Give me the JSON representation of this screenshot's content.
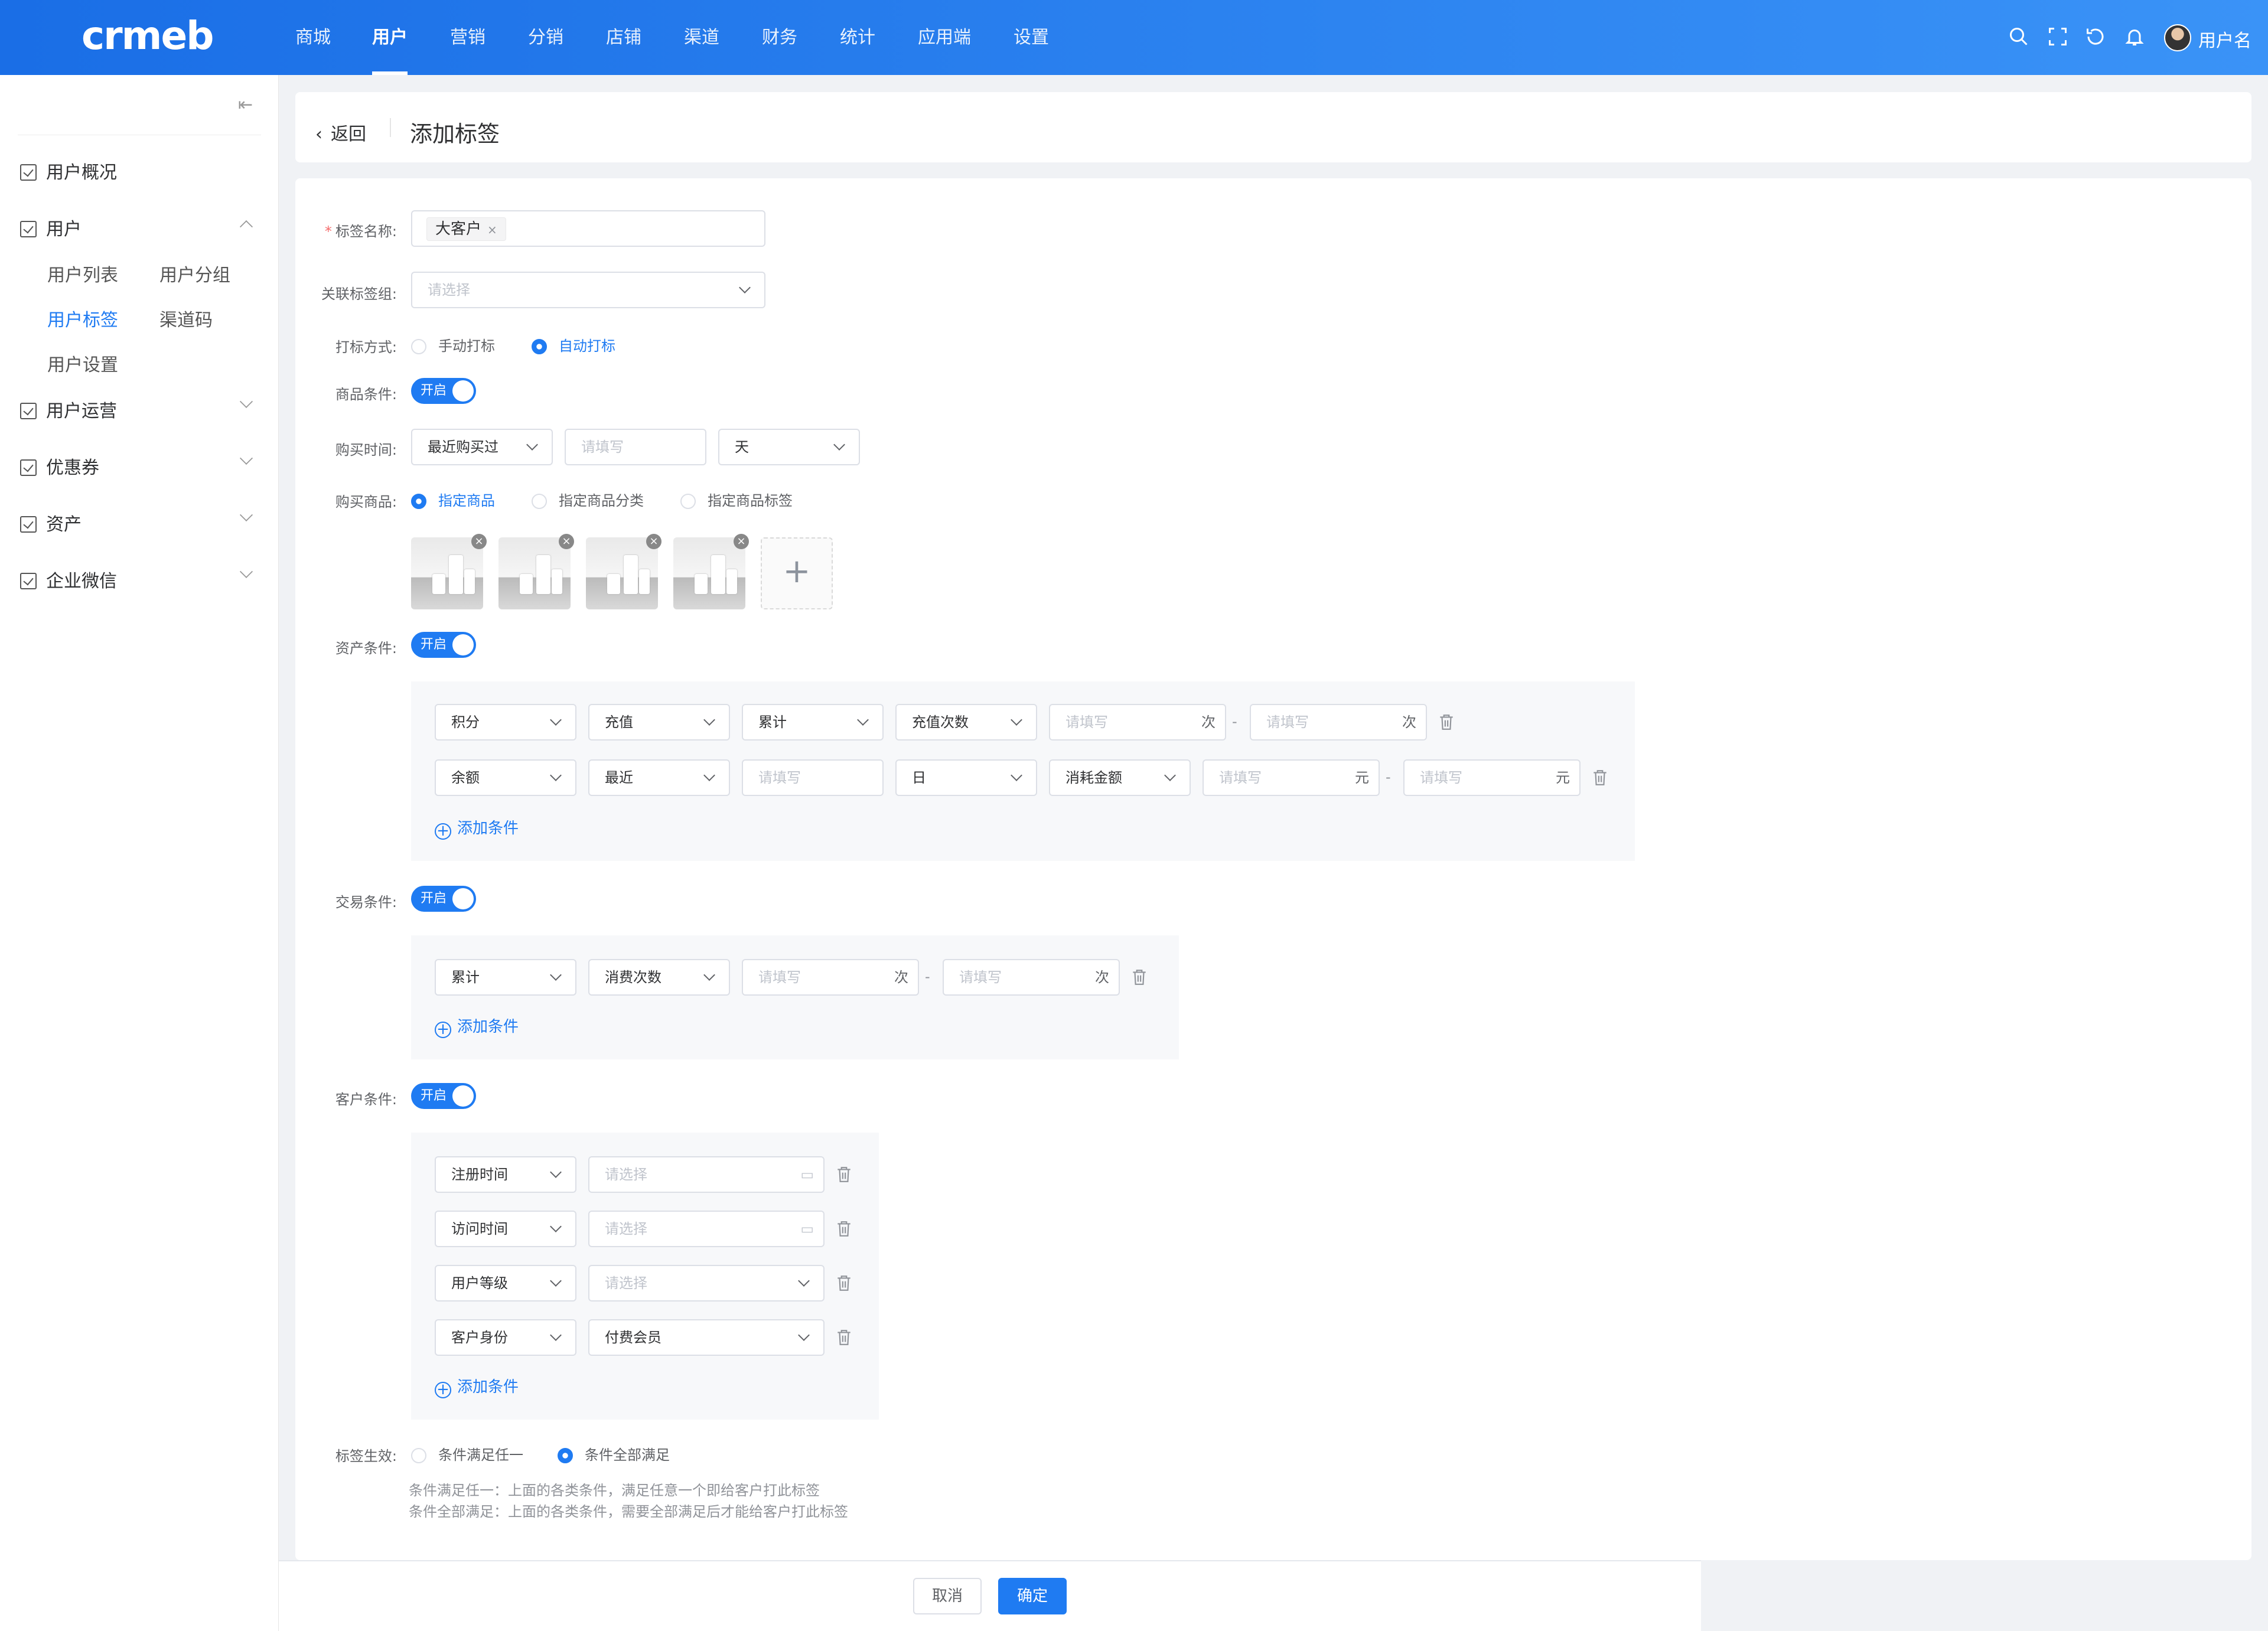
{
  "header": {
    "logo": "crmeb",
    "nav": [
      "商城",
      "用户",
      "营销",
      "分销",
      "店铺",
      "渠道",
      "财务",
      "统计",
      "应用端",
      "设置"
    ],
    "active_nav": "用户",
    "username": "用户名",
    "icons": [
      "search-icon",
      "fullscreen-icon",
      "refresh-icon",
      "bell-icon"
    ]
  },
  "sidebar": {
    "menus": [
      "用户概况",
      "用户",
      "用户运营",
      "优惠券",
      "资产",
      "企业微信"
    ],
    "submenu": [
      "用户列表",
      "用户分组",
      "用户标签",
      "渠道码",
      "用户设置"
    ],
    "active_sub": "用户标签"
  },
  "page": {
    "back": "返回",
    "title": "添加标签"
  },
  "form": {
    "labels": {
      "name": "标签名称:",
      "group": "关联标签组:",
      "method": "打标方式:",
      "goods_cond": "商品条件:",
      "buy_time": "购买时间:",
      "buy_goods": "购买商品:",
      "asset_cond": "资产条件:",
      "trade_cond": "交易条件:",
      "customer_cond": "客户条件:",
      "effect": "标签生效:"
    },
    "tag_value": "大客户",
    "group_placeholder": "请选择",
    "method_options": [
      "手动打标",
      "自动打标"
    ],
    "switch_label": "开启",
    "buy_time": {
      "select1": "最近购买过",
      "placeholder": "请填写",
      "unit": "天"
    },
    "buy_goods_options": [
      "指定商品",
      "指定商品分类",
      "指定商品标签"
    ],
    "asset_rows": [
      {
        "s1": "积分",
        "s2": "充值",
        "s3": "累计",
        "s4": "充值次数",
        "p1": "请填写",
        "u1": "次",
        "p2": "请填写",
        "u2": "次"
      },
      {
        "s1": "余额",
        "s2": "最近",
        "p0": "请填写",
        "s3": "日",
        "s4": "消耗金额",
        "p1": "请填写",
        "u1": "元",
        "p2": "请填写",
        "u2": "元"
      }
    ],
    "trade_row": {
      "s1": "累计",
      "s2": "消费次数",
      "p1": "请填写",
      "u1": "次",
      "p2": "请填写",
      "u2": "次"
    },
    "customer_rows": [
      {
        "s1": "注册时间",
        "v": "请选择"
      },
      {
        "s1": "访问时间",
        "v": "请选择"
      },
      {
        "s1": "用户等级",
        "v": "请选择"
      },
      {
        "s1": "客户身份",
        "v": "付费会员"
      }
    ],
    "add_condition": "添加条件",
    "effect_options": [
      "条件满足任一",
      "条件全部满足"
    ],
    "tips": [
      "条件满足任一：上面的各类条件，满足任意一个即给客户打此标签",
      "条件全部满足：上面的各类条件，需要全部满足后才能给客户打此标签"
    ],
    "dash": "-"
  },
  "footer": {
    "cancel": "取消",
    "ok": "确定"
  },
  "colors": {
    "primary": "#1f7bf2",
    "header_start": "#1a6ee6",
    "header_end": "#3a93f7"
  }
}
